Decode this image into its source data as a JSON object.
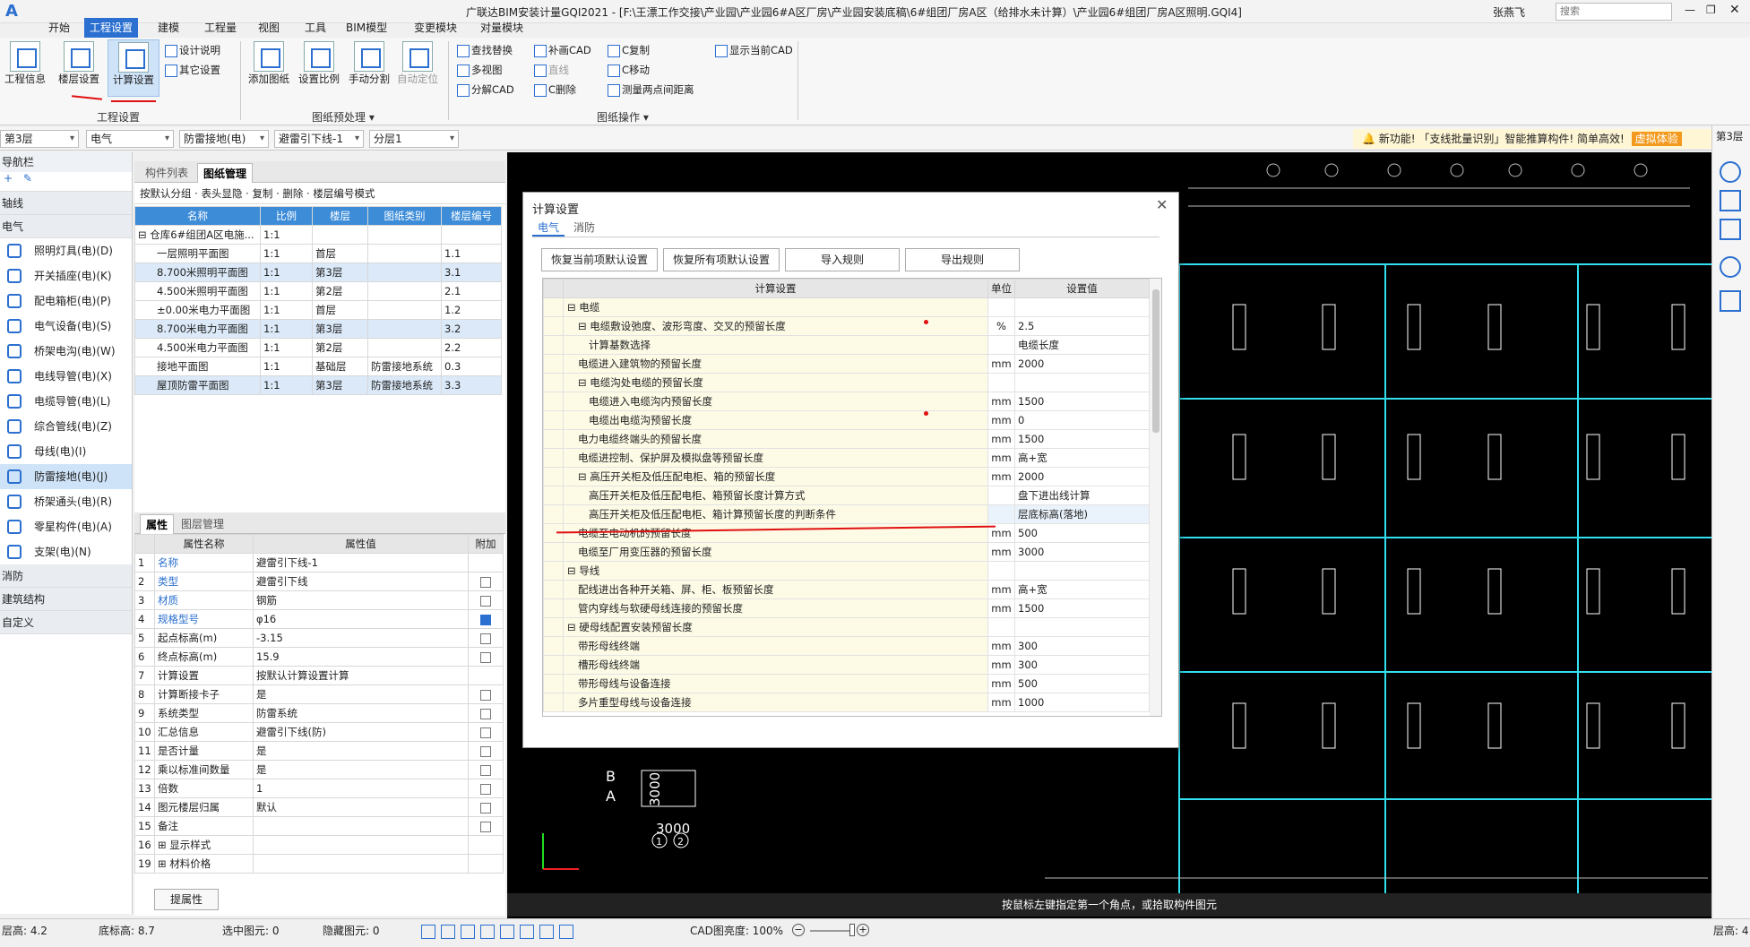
{
  "app": {
    "title": "广联达BIM安装计量GQI2021 - [F:\\王漂工作交接\\产业园\\产业园6#A区厂房\\产业园安装底稿\\6#组团厂房A区（给排水未计算）\\产业园6#组团厂房A区照明.GQI4]",
    "user": "张燕飞",
    "search_placeholder": "搜索"
  },
  "menu": [
    "开始",
    "工程设置",
    "建模",
    "工程量",
    "视图",
    "工具",
    "BIM模型",
    "变更模块",
    "对量模块"
  ],
  "ribbon": {
    "big_buttons": [
      "工程信息",
      "楼层设置",
      "计算设置",
      "添加图纸",
      "设置比例",
      "手动分割",
      "自动定位"
    ],
    "small_buttons": [
      "设计说明",
      "其它设置",
      "查找替换",
      "多视图",
      "分解CAD",
      "补画CAD",
      "直线",
      "C删除",
      "C复制",
      "C移动",
      "测量两点间距离",
      "显示当前CAD"
    ],
    "groups": [
      "工程设置",
      "图纸预处理 ▾",
      "图纸操作 ▾"
    ]
  },
  "toolbar2": {
    "combos": [
      "第3层",
      "电气",
      "防雷接地(电)",
      "避雷引下线-1",
      "分层1"
    ],
    "notice": "新功能! 「支线批量识别」智能推算构件! 简单高效!",
    "notice_badge": "虚拟体验",
    "right_floor": "第3层"
  },
  "nav": {
    "header": "导航栏",
    "groups_top": [
      "轴线",
      "电气"
    ],
    "items": [
      "照明灯具(电)(D)",
      "开关插座(电)(K)",
      "配电箱柜(电)(P)",
      "电气设备(电)(S)",
      "桥架电沟(电)(W)",
      "电线导管(电)(X)",
      "电缆导管(电)(L)",
      "综合管线(电)(Z)",
      "母线(电)(I)",
      "防雷接地(电)(J)",
      "桥架通头(电)(R)",
      "零星构件(电)(A)",
      "支架(电)(N)"
    ],
    "groups_bottom": [
      "消防",
      "建筑结构",
      "自定义"
    ]
  },
  "drawing_panel": {
    "tabs": [
      "构件列表",
      "图纸管理"
    ],
    "tools": [
      "按默认分组",
      "表头显隐",
      "复制",
      "删除",
      "楼层编号模式"
    ],
    "headers": [
      "名称",
      "比例",
      "楼层",
      "图纸类别",
      "楼层编号"
    ],
    "rows": [
      {
        "name": "⊟ 仓库6#组团A区电施...",
        "scale": "1:1",
        "floor": "",
        "type": "",
        "num": ""
      },
      {
        "name": "一层照明平面图",
        "scale": "1:1",
        "floor": "首层",
        "type": "",
        "num": "1.1"
      },
      {
        "name": "8.700米照明平面图",
        "scale": "1:1",
        "floor": "第3层",
        "type": "",
        "num": "3.1"
      },
      {
        "name": "4.500米照明平面图",
        "scale": "1:1",
        "floor": "第2层",
        "type": "",
        "num": "2.1"
      },
      {
        "name": "±0.00米电力平面图",
        "scale": "1:1",
        "floor": "首层",
        "type": "",
        "num": "1.2"
      },
      {
        "name": "8.700米电力平面图",
        "scale": "1:1",
        "floor": "第3层",
        "type": "",
        "num": "3.2"
      },
      {
        "name": "4.500米电力平面图",
        "scale": "1:1",
        "floor": "第2层",
        "type": "",
        "num": "2.2"
      },
      {
        "name": "接地平面图",
        "scale": "1:1",
        "floor": "基础层",
        "type": "防雷接地系统",
        "num": "0.3"
      },
      {
        "name": "屋顶防雷平面图",
        "scale": "1:1",
        "floor": "第3层",
        "type": "防雷接地系统",
        "num": "3.3"
      }
    ]
  },
  "props_panel": {
    "tabs": [
      "属性",
      "图层管理"
    ],
    "headers": [
      "属性名称",
      "属性值",
      "附加"
    ],
    "rows": [
      {
        "n": "1",
        "name": "名称",
        "val": "避雷引下线-1",
        "chk": "none",
        "blue": true
      },
      {
        "n": "2",
        "name": "类型",
        "val": "避雷引下线",
        "chk": "off",
        "blue": true
      },
      {
        "n": "3",
        "name": "材质",
        "val": "钢筋",
        "chk": "off",
        "blue": true
      },
      {
        "n": "4",
        "name": "规格型号",
        "val": "φ16",
        "chk": "on",
        "blue": true
      },
      {
        "n": "5",
        "name": "起点标高(m)",
        "val": "-3.15",
        "chk": "off",
        "blue": false
      },
      {
        "n": "6",
        "name": "终点标高(m)",
        "val": "15.9",
        "chk": "off",
        "blue": false
      },
      {
        "n": "7",
        "name": "计算设置",
        "val": "按默认计算设置计算",
        "chk": "none",
        "blue": false
      },
      {
        "n": "8",
        "name": "计算断接卡子",
        "val": "是",
        "chk": "off",
        "blue": false
      },
      {
        "n": "9",
        "name": "系统类型",
        "val": "防雷系统",
        "chk": "off",
        "blue": false
      },
      {
        "n": "10",
        "name": "汇总信息",
        "val": "避雷引下线(防)",
        "chk": "off",
        "blue": false
      },
      {
        "n": "11",
        "name": "是否计量",
        "val": "是",
        "chk": "off",
        "blue": false
      },
      {
        "n": "12",
        "name": "乘以标准间数量",
        "val": "是",
        "chk": "off",
        "blue": false
      },
      {
        "n": "13",
        "name": "倍数",
        "val": "1",
        "chk": "off",
        "blue": false
      },
      {
        "n": "14",
        "name": "图元楼层归属",
        "val": "默认",
        "chk": "off",
        "blue": false
      },
      {
        "n": "15",
        "name": "备注",
        "val": "",
        "chk": "off",
        "blue": false
      },
      {
        "n": "16",
        "name": "⊞ 显示样式",
        "val": "",
        "chk": "none",
        "blue": false
      },
      {
        "n": "19",
        "name": "⊞ 材料价格",
        "val": "",
        "chk": "none",
        "blue": false
      }
    ],
    "button": "提属性"
  },
  "dialog": {
    "title": "计算设置",
    "tabs": [
      "电气",
      "消防"
    ],
    "buttons": [
      "恢复当前项默认设置",
      "恢复所有项默认设置",
      "导入规则",
      "导出规则"
    ],
    "headers": [
      "计算设置",
      "单位",
      "设置值"
    ],
    "rows": [
      {
        "lvl": 0,
        "t": "⊟ 电缆",
        "u": "",
        "v": ""
      },
      {
        "lvl": 1,
        "t": "⊟ 电缆敷设弛度、波形弯度、交叉的预留长度",
        "u": "%",
        "v": "2.5"
      },
      {
        "lvl": 2,
        "t": "计算基数选择",
        "u": "",
        "v": "电缆长度"
      },
      {
        "lvl": 1,
        "t": "电缆进入建筑物的预留长度",
        "u": "mm",
        "v": "2000"
      },
      {
        "lvl": 1,
        "t": "⊟ 电缆沟处电缆的预留长度",
        "u": "",
        "v": ""
      },
      {
        "lvl": 2,
        "t": "电缆进入电缆沟内预留长度",
        "u": "mm",
        "v": "1500"
      },
      {
        "lvl": 2,
        "t": "电缆出电缆沟预留长度",
        "u": "mm",
        "v": "0"
      },
      {
        "lvl": 1,
        "t": "电力电缆终端头的预留长度",
        "u": "mm",
        "v": "1500"
      },
      {
        "lvl": 1,
        "t": "电缆进控制、保护屏及模拟盘等预留长度",
        "u": "mm",
        "v": "高+宽"
      },
      {
        "lvl": 1,
        "t": "⊟ 高压开关柜及低压配电柜、箱的预留长度",
        "u": "mm",
        "v": "2000"
      },
      {
        "lvl": 2,
        "t": "高压开关柜及低压配电柜、箱预留长度计算方式",
        "u": "",
        "v": "盘下进出线计算"
      },
      {
        "lvl": 2,
        "t": "高压开关柜及低压配电柜、箱计算预留长度的判断条件",
        "u": "",
        "v": "层底标高(落地)"
      },
      {
        "lvl": 1,
        "t": "电缆至电动机的预留长度",
        "u": "mm",
        "v": "500"
      },
      {
        "lvl": 1,
        "t": "电缆至厂用变压器的预留长度",
        "u": "mm",
        "v": "3000"
      },
      {
        "lvl": 0,
        "t": "⊟ 导线",
        "u": "",
        "v": ""
      },
      {
        "lvl": 1,
        "t": "配线进出各种开关箱、屏、柜、板预留长度",
        "u": "mm",
        "v": "高+宽"
      },
      {
        "lvl": 1,
        "t": "管内穿线与软硬母线连接的预留长度",
        "u": "mm",
        "v": "1500"
      },
      {
        "lvl": 0,
        "t": "⊟ 硬母线配置安装预留长度",
        "u": "",
        "v": ""
      },
      {
        "lvl": 1,
        "t": "带形母线终端",
        "u": "mm",
        "v": "300"
      },
      {
        "lvl": 1,
        "t": "槽形母线终端",
        "u": "mm",
        "v": "300"
      },
      {
        "lvl": 1,
        "t": "带形母线与设备连接",
        "u": "mm",
        "v": "500"
      },
      {
        "lvl": 1,
        "t": "多片重型母线与设备连接",
        "u": "mm",
        "v": "1000"
      }
    ]
  },
  "cad": {
    "status": "按鼠标左键指定第一个角点，或拾取构件图元",
    "labels": [
      "B",
      "A",
      "3000",
      "3000",
      "1",
      "2"
    ]
  },
  "statusbar": {
    "floor_height": "层高: 4.2",
    "base_elev": "底标高: 8.7",
    "selected": "选中图元: 0",
    "hidden": "隐藏图元: 0",
    "cad_brightness": "CAD图亮度: 100%",
    "right_floor_height": "层高: 4"
  },
  "colors": {
    "accent": "#2b6fd0",
    "cad_line": "#33e0f0",
    "dialog_cell": "#fdfbe6",
    "annotation": "#e01010"
  }
}
